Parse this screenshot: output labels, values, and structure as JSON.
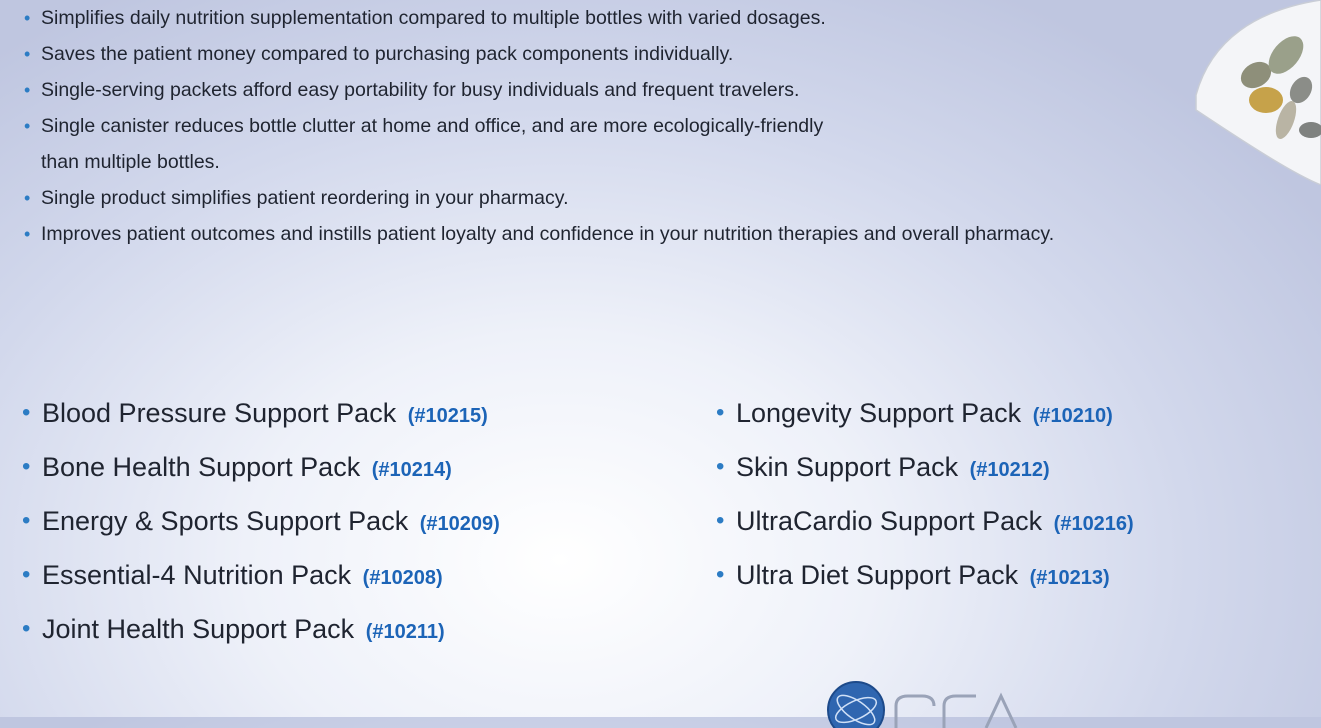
{
  "benefits": [
    "Simplifies daily nutrition supplementation compared to multiple bottles with varied dosages.",
    "Saves the patient money compared to purchasing pack components individually.",
    "Single-serving packets afford easy portability for busy individuals and frequent travelers.",
    "Single canister reduces bottle clutter at home and office, and are more ecologically-friendly than multiple bottles.",
    "Single product simplifies patient reordering in your pharmacy.",
    "Improves patient outcomes and instills patient loyalty and confidence in your nutrition therapies and overall pharmacy."
  ],
  "packs_left": [
    {
      "name": "Blood Pressure Support Pack",
      "code": "(#10215)"
    },
    {
      "name": "Bone Health Support Pack",
      "code": "(#10214)"
    },
    {
      "name": "Energy & Sports Support Pack",
      "code": "(#10209)"
    },
    {
      "name": "Essential-4 Nutrition Pack",
      "code": "(#10208)"
    },
    {
      "name": "Joint Health Support Pack",
      "code": "(#10211)"
    }
  ],
  "packs_right": [
    {
      "name": "Longevity Support Pack",
      "code": "(#10210)"
    },
    {
      "name": "Skin Support Pack",
      "code": "(#10212)"
    },
    {
      "name": "UltraCardio Support Pack",
      "code": "(#10216)"
    },
    {
      "name": "Ultra Diet Support Pack",
      "code": "(#10213)"
    }
  ],
  "colors": {
    "bullet": "#2c7cc4",
    "code": "#1c64b7",
    "text": "#1f2430"
  }
}
